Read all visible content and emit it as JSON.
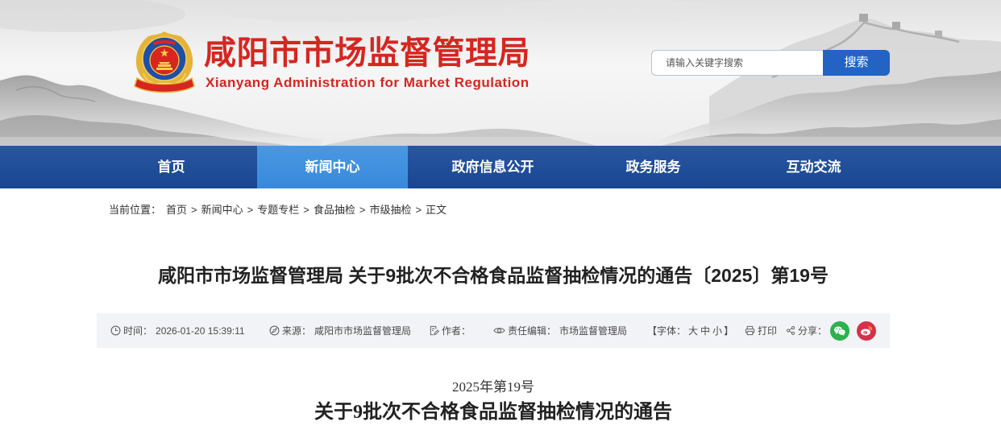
{
  "site": {
    "title": "咸阳市市场监督管理局",
    "subtitle": "Xianyang Administration for Market Regulation",
    "logo_icon": "market-regulation-emblem-icon"
  },
  "search": {
    "placeholder": "请输入关键字搜索",
    "button_label": "搜索"
  },
  "nav": {
    "items": [
      {
        "label": "首页",
        "active": false
      },
      {
        "label": "新闻中心",
        "active": true
      },
      {
        "label": "政府信息公开",
        "active": false
      },
      {
        "label": "政务服务",
        "active": false
      },
      {
        "label": "互动交流",
        "active": false
      }
    ]
  },
  "breadcrumb": {
    "prefix": "当前位置：",
    "separator": ">",
    "items": [
      "首页",
      "新闻中心",
      "专题专栏",
      "食品抽检",
      "市级抽检",
      "正文"
    ]
  },
  "article": {
    "title": "咸阳市市场监督管理局 关于9批次不合格食品监督抽检情况的通告〔2025〕第19号",
    "meta": {
      "time_label": "时间：",
      "time_value": "2026-01-20 15:39:11",
      "source_label": "来源：",
      "source_value": "咸阳市市场监督管理局",
      "author_label": "作者：",
      "editor_label": "责任编辑：",
      "editor_value": "市场监督管理局",
      "font_size": {
        "open": "【字体：",
        "options": [
          "大",
          "中",
          "小"
        ],
        "close": "】"
      },
      "print_label": "打印",
      "share_label": "分享：",
      "share_targets": [
        "wechat-icon",
        "weibo-icon"
      ]
    },
    "doc_number": "2025年第19号",
    "heading": "关于9批次不合格食品监督抽检情况的通告"
  },
  "icons": {
    "time": "clock-icon",
    "source": "compass-icon",
    "author": "edit-icon",
    "editor": "eye-icon",
    "print": "print-icon",
    "share": "share-icon"
  },
  "colors": {
    "brand_red": "#d52620",
    "nav_blue": "#1b4c9c",
    "nav_active": "#3a8fe2",
    "search_button": "#2263c4",
    "meta_bar_bg": "#f2f3f6",
    "wechat_green": "#2bb24c",
    "weibo_red": "#d6304a"
  }
}
